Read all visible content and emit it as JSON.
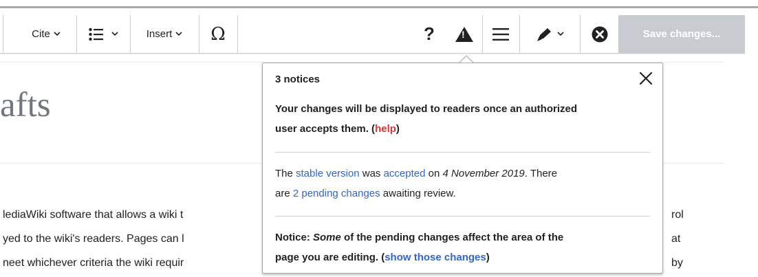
{
  "toolbar": {
    "cite_label": "Cite",
    "insert_label": "Insert",
    "special_char_glyph": "Ω",
    "help_glyph": "?",
    "notices_glyph": "!",
    "save_label": "Save changes..."
  },
  "page": {
    "title_fragment": "afts",
    "body_lines": [
      "lediaWiki software that allows a wiki t",
      "yed to the wiki's readers. Pages can l",
      "neet whichever criteria the wiki requir"
    ],
    "right_fragments": [
      "rol",
      "at",
      "by"
    ]
  },
  "notices_popup": {
    "title": "3 notices",
    "notice1": {
      "line1": "Your changes will be displayed to readers once an authorized",
      "line2_text": "user accepts them. (",
      "line2_link": "help",
      "line2_end": ")"
    },
    "notice2": {
      "p1": "The ",
      "link1": "stable version",
      "p2": " was ",
      "link2": "accepted",
      "p3": " on ",
      "date": "4 November 2019",
      "p4": ". There",
      "p5": "are ",
      "link3": "2 pending changes",
      "p6": " awaiting review."
    },
    "notice3": {
      "label": "Notice: ",
      "emph": "Some",
      "text": " of the pending changes affect the area of the",
      "line2_text": "page you are editing. (",
      "line2_link": "show those changes",
      "line2_end": ")"
    }
  },
  "colors": {
    "link": "#3366cc",
    "help_link": "#d33",
    "save_button_bg": "#c8ccd1"
  },
  "icons": [
    "chevron-down-icon",
    "bullet-list-icon",
    "special-character-icon",
    "help-icon",
    "warning-icon",
    "menu-icon",
    "edit-pencil-icon",
    "close-circle-icon",
    "close-icon"
  ]
}
